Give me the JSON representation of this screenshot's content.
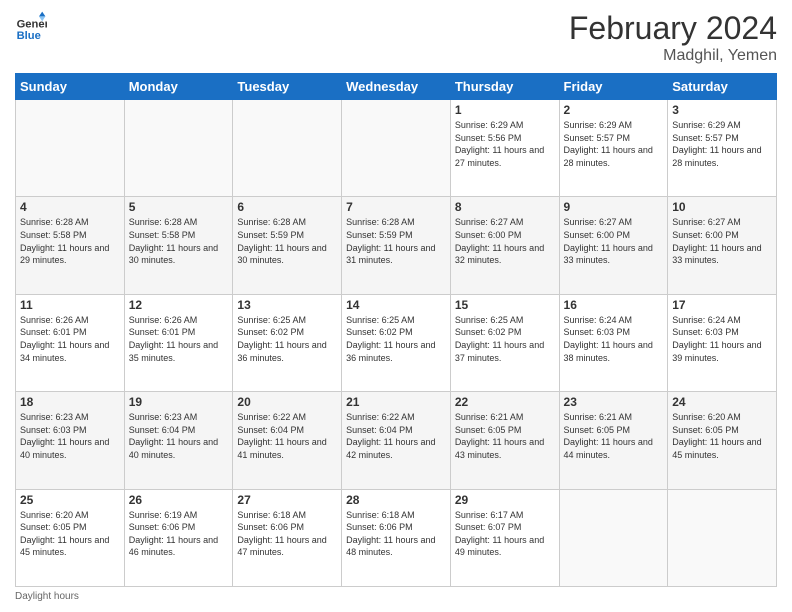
{
  "header": {
    "logo_general": "General",
    "logo_blue": "Blue",
    "month_year": "February 2024",
    "location": "Madghil, Yemen"
  },
  "days_of_week": [
    "Sunday",
    "Monday",
    "Tuesday",
    "Wednesday",
    "Thursday",
    "Friday",
    "Saturday"
  ],
  "weeks": [
    [
      {
        "day": "",
        "sunrise": "",
        "sunset": "",
        "daylight": "",
        "empty": true
      },
      {
        "day": "",
        "sunrise": "",
        "sunset": "",
        "daylight": "",
        "empty": true
      },
      {
        "day": "",
        "sunrise": "",
        "sunset": "",
        "daylight": "",
        "empty": true
      },
      {
        "day": "",
        "sunrise": "",
        "sunset": "",
        "daylight": "",
        "empty": true
      },
      {
        "day": "1",
        "sunrise": "6:29 AM",
        "sunset": "5:56 PM",
        "daylight": "11 hours and 27 minutes."
      },
      {
        "day": "2",
        "sunrise": "6:29 AM",
        "sunset": "5:57 PM",
        "daylight": "11 hours and 28 minutes."
      },
      {
        "day": "3",
        "sunrise": "6:29 AM",
        "sunset": "5:57 PM",
        "daylight": "11 hours and 28 minutes."
      }
    ],
    [
      {
        "day": "4",
        "sunrise": "6:28 AM",
        "sunset": "5:58 PM",
        "daylight": "11 hours and 29 minutes."
      },
      {
        "day": "5",
        "sunrise": "6:28 AM",
        "sunset": "5:58 PM",
        "daylight": "11 hours and 30 minutes."
      },
      {
        "day": "6",
        "sunrise": "6:28 AM",
        "sunset": "5:59 PM",
        "daylight": "11 hours and 30 minutes."
      },
      {
        "day": "7",
        "sunrise": "6:28 AM",
        "sunset": "5:59 PM",
        "daylight": "11 hours and 31 minutes."
      },
      {
        "day": "8",
        "sunrise": "6:27 AM",
        "sunset": "6:00 PM",
        "daylight": "11 hours and 32 minutes."
      },
      {
        "day": "9",
        "sunrise": "6:27 AM",
        "sunset": "6:00 PM",
        "daylight": "11 hours and 33 minutes."
      },
      {
        "day": "10",
        "sunrise": "6:27 AM",
        "sunset": "6:00 PM",
        "daylight": "11 hours and 33 minutes."
      }
    ],
    [
      {
        "day": "11",
        "sunrise": "6:26 AM",
        "sunset": "6:01 PM",
        "daylight": "11 hours and 34 minutes."
      },
      {
        "day": "12",
        "sunrise": "6:26 AM",
        "sunset": "6:01 PM",
        "daylight": "11 hours and 35 minutes."
      },
      {
        "day": "13",
        "sunrise": "6:25 AM",
        "sunset": "6:02 PM",
        "daylight": "11 hours and 36 minutes."
      },
      {
        "day": "14",
        "sunrise": "6:25 AM",
        "sunset": "6:02 PM",
        "daylight": "11 hours and 36 minutes."
      },
      {
        "day": "15",
        "sunrise": "6:25 AM",
        "sunset": "6:02 PM",
        "daylight": "11 hours and 37 minutes."
      },
      {
        "day": "16",
        "sunrise": "6:24 AM",
        "sunset": "6:03 PM",
        "daylight": "11 hours and 38 minutes."
      },
      {
        "day": "17",
        "sunrise": "6:24 AM",
        "sunset": "6:03 PM",
        "daylight": "11 hours and 39 minutes."
      }
    ],
    [
      {
        "day": "18",
        "sunrise": "6:23 AM",
        "sunset": "6:03 PM",
        "daylight": "11 hours and 40 minutes."
      },
      {
        "day": "19",
        "sunrise": "6:23 AM",
        "sunset": "6:04 PM",
        "daylight": "11 hours and 40 minutes."
      },
      {
        "day": "20",
        "sunrise": "6:22 AM",
        "sunset": "6:04 PM",
        "daylight": "11 hours and 41 minutes."
      },
      {
        "day": "21",
        "sunrise": "6:22 AM",
        "sunset": "6:04 PM",
        "daylight": "11 hours and 42 minutes."
      },
      {
        "day": "22",
        "sunrise": "6:21 AM",
        "sunset": "6:05 PM",
        "daylight": "11 hours and 43 minutes."
      },
      {
        "day": "23",
        "sunrise": "6:21 AM",
        "sunset": "6:05 PM",
        "daylight": "11 hours and 44 minutes."
      },
      {
        "day": "24",
        "sunrise": "6:20 AM",
        "sunset": "6:05 PM",
        "daylight": "11 hours and 45 minutes."
      }
    ],
    [
      {
        "day": "25",
        "sunrise": "6:20 AM",
        "sunset": "6:05 PM",
        "daylight": "11 hours and 45 minutes."
      },
      {
        "day": "26",
        "sunrise": "6:19 AM",
        "sunset": "6:06 PM",
        "daylight": "11 hours and 46 minutes."
      },
      {
        "day": "27",
        "sunrise": "6:18 AM",
        "sunset": "6:06 PM",
        "daylight": "11 hours and 47 minutes."
      },
      {
        "day": "28",
        "sunrise": "6:18 AM",
        "sunset": "6:06 PM",
        "daylight": "11 hours and 48 minutes."
      },
      {
        "day": "29",
        "sunrise": "6:17 AM",
        "sunset": "6:07 PM",
        "daylight": "11 hours and 49 minutes."
      },
      {
        "day": "",
        "sunrise": "",
        "sunset": "",
        "daylight": "",
        "empty": true
      },
      {
        "day": "",
        "sunrise": "",
        "sunset": "",
        "daylight": "",
        "empty": true
      }
    ]
  ],
  "footer": {
    "note": "Daylight hours"
  }
}
